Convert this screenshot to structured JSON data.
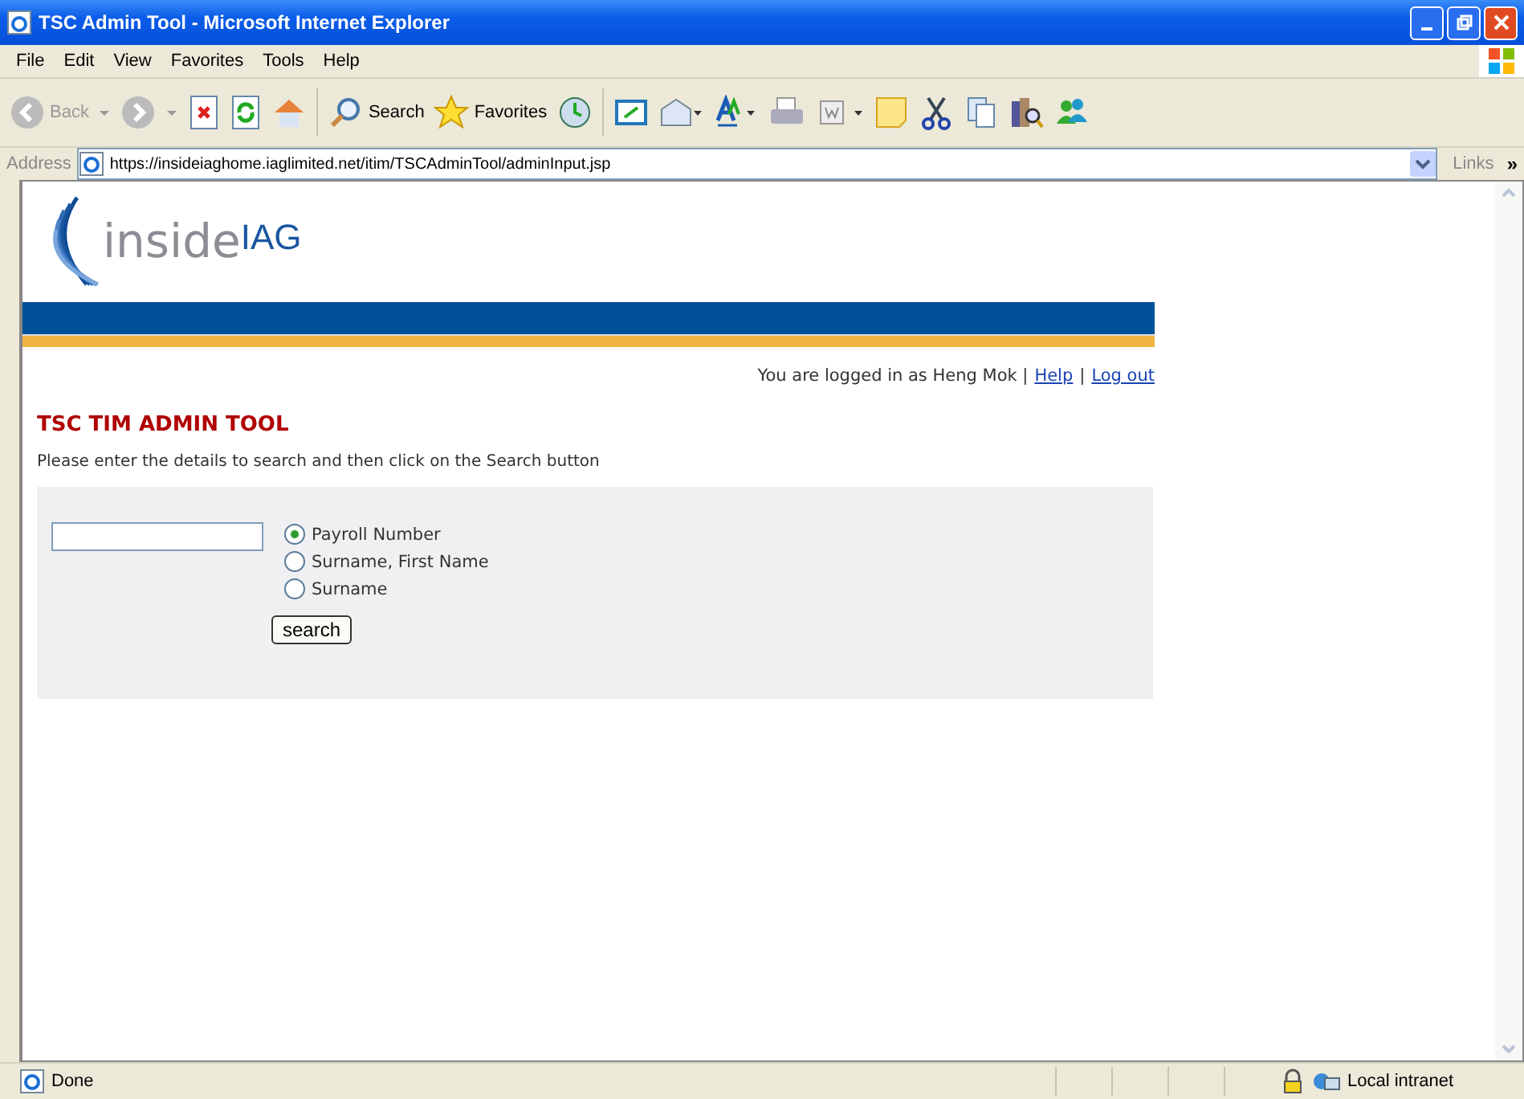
{
  "window": {
    "title": "TSC Admin Tool - Microsoft Internet Explorer"
  },
  "menu": [
    "File",
    "Edit",
    "View",
    "Favorites",
    "Tools",
    "Help"
  ],
  "toolbar": {
    "back": "Back",
    "search": "Search",
    "favorites": "Favorites"
  },
  "address": {
    "label": "Address",
    "url": "https://insideiaghome.iaglimited.net/itim/TSCAdminTool/adminInput.jsp",
    "links": "Links",
    "more": "»"
  },
  "logo": {
    "word": "inside",
    "mark": "IAG"
  },
  "userbar": {
    "text": "You are logged in as Heng Mok |",
    "help": "Help",
    "separator": "|",
    "logout": "Log out"
  },
  "heading": "TSC TIM ADMIN TOOL",
  "instructions": "Please enter the details to search and then click on the Search button",
  "form": {
    "options": [
      {
        "label": "Payroll Number",
        "selected": true
      },
      {
        "label": "Surname, First Name",
        "selected": false
      },
      {
        "label": "Surname",
        "selected": false
      }
    ],
    "button": "search"
  },
  "status_bar": {
    "text": "Done",
    "zone": "Local intranet"
  }
}
